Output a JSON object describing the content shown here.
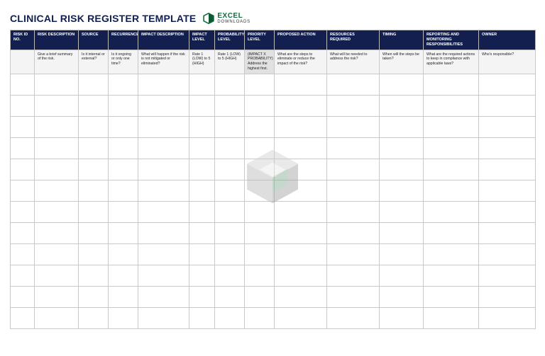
{
  "title": "CLINICAL RISK REGISTER TEMPLATE",
  "logo": {
    "line1": "EXCEL",
    "line2": "DOWNLOADS"
  },
  "headers": {
    "risk_id": "RISK ID NO.",
    "risk_desc": "RISK DESCRIPTION",
    "source": "SOURCE",
    "recurrence": "RECURRENCE",
    "impact_desc": "IMPACT DESCRIPTION",
    "impact_level": "IMPACT LEVEL",
    "prob_level": "PROBABILITY LEVEL",
    "priority_level": "PRIORITY LEVEL",
    "proposed_action": "PROPOSED ACTION",
    "resources": "RESOURCES REQUIRED",
    "timing": "TIMING",
    "reporting": "REPORTING AND MONITORING RESPONSIBILITIES",
    "owner": "OWNER"
  },
  "sub": {
    "risk_id": "",
    "risk_desc": "Give a brief summary of the risk.",
    "source": "Is it internal or external?",
    "recurrence": "Is it ongoing or only one time?",
    "impact_desc": "What will happen if the risk is not mitigated or eliminated?",
    "impact_level": "Rate 1 (LOW) to 5 (HIGH)",
    "prob_level": "Rate 1 (LOW) to 5 (HIGH)",
    "priority_level": "(IMPACT X PROBABILITY) Address the highest first.",
    "proposed_action": "What are the steps to eliminate or reduce the impact of the risk?",
    "resources": "What will be needed to address the risk?",
    "timing": "When will the steps be taken?",
    "reporting": "What are the required actions to keep in compliance with applicable laws?",
    "owner": "Who's responsible?"
  },
  "rows": 12
}
